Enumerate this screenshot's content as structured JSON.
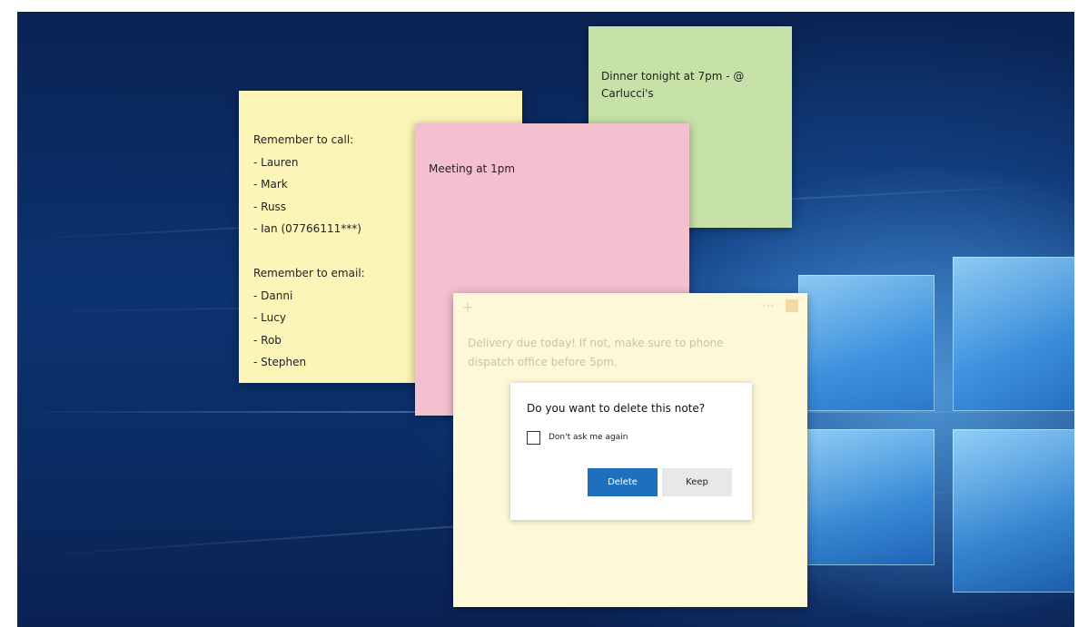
{
  "desktop": {
    "os": "Windows 10"
  },
  "notes": {
    "yellow": {
      "color": "#fbf5b7",
      "lines": [
        "Remember to call:",
        "- Lauren",
        "- Mark",
        "- Russ",
        "- Ian (07766111***)",
        "",
        "Remember to email:",
        "- Danni",
        "- Lucy",
        "- Rob",
        "- Stephen"
      ]
    },
    "green": {
      "color": "#c6e2a8",
      "text": "Dinner tonight at 7pm - @ Carlucci's"
    },
    "pink": {
      "color": "#f4bfcf",
      "text": "Meeting at 1pm"
    },
    "cream": {
      "color": "#fdf8d8",
      "text": "Delivery due today! If not, make sure to phone dispatch office before 5pm.",
      "icons": [
        "add-icon",
        "menu-icon",
        "close-icon"
      ]
    }
  },
  "dialog": {
    "question": "Do you want to delete this note?",
    "checkbox_label": "Don't ask me again",
    "checkbox_checked": false,
    "delete_label": "Delete",
    "keep_label": "Keep",
    "accent": "#1f6fbf"
  }
}
